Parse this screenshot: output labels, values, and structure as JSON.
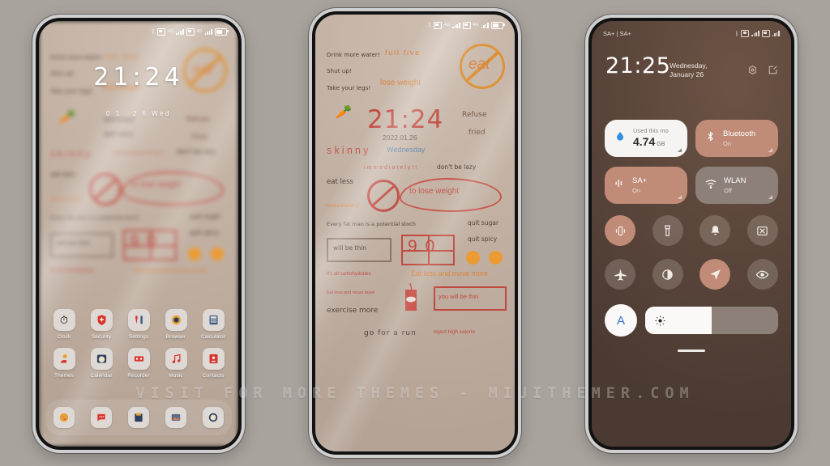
{
  "background_color": "#a9a39e",
  "watermark": "VISIT FOR MORE THEMES - MIUITHEMER.COM",
  "accent_salmon": "#c08b77",
  "accent_red": "#c0493f",
  "accent_orange": "#dd9238",
  "statusbar": {
    "bluetooth": "bluetooth-icon",
    "sim1": "4G",
    "sim2": "4G"
  },
  "phone1": {
    "name": "lock-screen",
    "clock": "21:24",
    "date": "0 1 . 2 6   Wed",
    "apps_row1": [
      {
        "label": "Clock",
        "icon": "clock-icon",
        "glyph": "⏱"
      },
      {
        "label": "Security",
        "icon": "shield-icon",
        "glyph": "➕"
      },
      {
        "label": "Settings",
        "icon": "settings-icon",
        "glyph": "⚙"
      },
      {
        "label": "Browser",
        "icon": "browser-icon",
        "glyph": "◎"
      },
      {
        "label": "Calculator",
        "icon": "calculator-icon",
        "glyph": "⊞"
      }
    ],
    "apps_row2": [
      {
        "label": "Themes",
        "icon": "themes-icon",
        "glyph": "❀"
      },
      {
        "label": "Calendar",
        "icon": "calendar-icon",
        "glyph": "○"
      },
      {
        "label": "Recorder",
        "icon": "recorder-icon",
        "glyph": "▭"
      },
      {
        "label": "Music",
        "icon": "music-icon",
        "glyph": "♫"
      },
      {
        "label": "Contacts",
        "icon": "contacts-icon",
        "glyph": "☺"
      }
    ],
    "dock": [
      {
        "icon": "phone-icon",
        "glyph": "☎"
      },
      {
        "icon": "messages-icon",
        "glyph": "ὊC"
      },
      {
        "icon": "notes-icon",
        "glyph": "▤"
      },
      {
        "icon": "gallery-icon",
        "glyph": "⛰"
      },
      {
        "icon": "browser-icon",
        "glyph": "○"
      }
    ]
  },
  "phone2": {
    "name": "home-screen-wallpaper",
    "clock": "21:24",
    "date": "2022.01.26",
    "weekday": "Wednesday",
    "wallpaper_text": {
      "drink_more_water": "Drink more water!",
      "full_five": "full five",
      "shut_up": "Shut up!",
      "lose_weight": "lose weight",
      "take_your_legs": "Take your legs!",
      "eat_banner": "eat",
      "refuse": "Refuse",
      "fried": "fried",
      "skinny": "skinny",
      "immediately_1": "immediately!!",
      "dont_be_lazy": "don't be lazy",
      "eat_less": "eat less",
      "immediately_2": "immediately!",
      "to_lose_weight": "to lose weight",
      "every_fat_man": "Every fat man is a potential stoch",
      "quit_sugar": "quit sugar",
      "will_be_thin": "will be thin",
      "ninety": "90",
      "quit_spicy": "quit spicy",
      "its_all_carbohydrates": "it's all carbohydrates",
      "eat_less_move_more_big": "Eat less and move more",
      "eat_less_move_more_small": "Eat less and move more",
      "exercise_more": "exercise more",
      "you_will_be_thin": "you will be thin",
      "go_for_a_run": "go for a run",
      "reject_high_calorie": "reject high calorie"
    }
  },
  "phone3": {
    "name": "control-center",
    "carrier": "SA+ | SA+",
    "time": "21:25",
    "date": "Wednesday, January 26",
    "header_icons": [
      {
        "name": "settings-gear-icon"
      },
      {
        "name": "edit-icon"
      }
    ],
    "tiles_row1": [
      {
        "name": "data-usage",
        "title": "Used this mo",
        "value": "4.74",
        "unit": "GB",
        "icon": "water-drop-icon",
        "style": "white"
      },
      {
        "name": "bluetooth",
        "title": "Bluetooth",
        "state": "On",
        "icon": "bluetooth-icon",
        "style": "salmon"
      }
    ],
    "tiles_row2": [
      {
        "name": "mobile-data",
        "title": "SA+",
        "state": "On",
        "icon": "signal-icon",
        "style": "salmon"
      },
      {
        "name": "wlan",
        "title": "WLAN",
        "state": "Off",
        "icon": "wifi-icon",
        "style": "gray"
      }
    ],
    "circles_row1": [
      {
        "name": "vibrate",
        "icon": "vibrate-icon",
        "active": true
      },
      {
        "name": "flashlight",
        "icon": "flashlight-icon",
        "active": false
      },
      {
        "name": "silent",
        "icon": "bell-icon",
        "active": false
      },
      {
        "name": "screenshot",
        "icon": "screenshot-icon",
        "active": false
      }
    ],
    "circles_row2": [
      {
        "name": "airplane-mode",
        "icon": "airplane-icon",
        "active": false
      },
      {
        "name": "dark-mode",
        "icon": "contrast-icon",
        "active": false
      },
      {
        "name": "location",
        "icon": "location-arrow-icon",
        "active": true
      },
      {
        "name": "reading-mode",
        "icon": "eye-icon",
        "active": false
      }
    ],
    "brightness": {
      "auto_label": "A",
      "icon": "brightness-icon",
      "percent": 50
    }
  }
}
